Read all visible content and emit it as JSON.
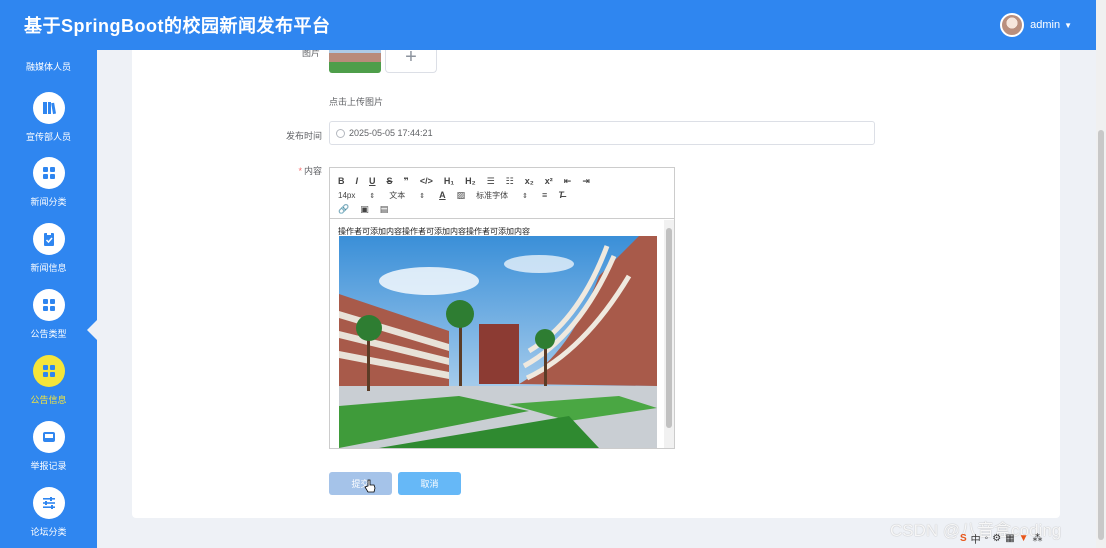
{
  "app": {
    "title": "基于SpringBoot的校园新闻发布平台"
  },
  "user": {
    "name": "admin"
  },
  "sidebar": {
    "partial_label": "融媒体人员",
    "items": [
      {
        "label": "宣传部人员",
        "icon": "book-icon"
      },
      {
        "label": "新闻分类",
        "icon": "grid-icon"
      },
      {
        "label": "新闻信息",
        "icon": "clipboard-check-icon"
      },
      {
        "label": "公告类型",
        "icon": "grid-icon"
      },
      {
        "label": "公告信息",
        "icon": "grid-icon",
        "active": true
      },
      {
        "label": "举报记录",
        "icon": "inbox-icon"
      },
      {
        "label": "论坛分类",
        "icon": "sliders-icon"
      }
    ]
  },
  "form": {
    "image_label": "图片",
    "upload_tip": "点击上传图片",
    "publish_time_label": "发布时间",
    "publish_time_value": "2025-05-05 17:44:21",
    "content_label": "内容",
    "content_required_mark": "*",
    "content_text": "操作者可添加内容操作者可添加内容操作者可添加内容",
    "submit_label": "提交",
    "cancel_label": "取消"
  },
  "editor": {
    "font_size": "14px",
    "text_style": "文本",
    "font_family": "标准字体",
    "toolbar_row1": [
      "B",
      "I",
      "U",
      "S",
      "❞",
      "</>",
      "H₁",
      "H₂",
      "☰",
      "☷",
      "x₂",
      "x²",
      "⇤",
      "⇥"
    ]
  },
  "overlay": {
    "watermark": "CSDN @八音盒coding",
    "ime_label": "中"
  },
  "colors": {
    "primary": "#2f86f0",
    "active": "#f5e53a",
    "submit": "#a5c3e9",
    "cancel": "#66b8f7"
  }
}
